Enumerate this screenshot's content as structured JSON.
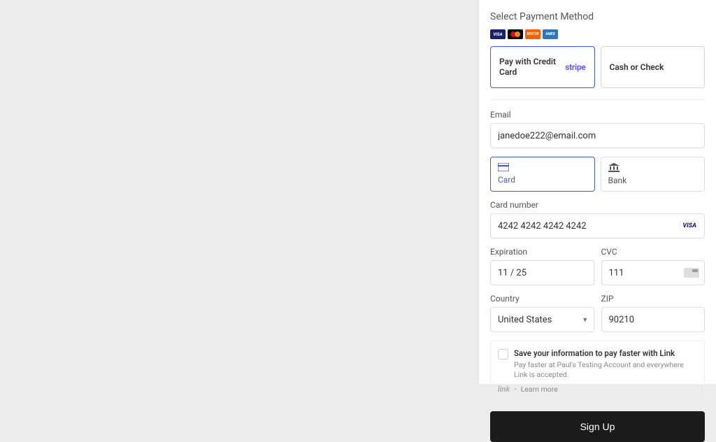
{
  "section_title": "Select Payment Method",
  "brands": {
    "visa": "VISA",
    "discover": "DISCVR",
    "amex": "AMEX"
  },
  "methods": {
    "credit": {
      "label": "Pay with Credit Card",
      "badge": "stripe"
    },
    "cash": {
      "label": "Cash or Check"
    }
  },
  "email": {
    "label": "Email",
    "value": "janedoe222@email.com"
  },
  "tabs": {
    "card": "Card",
    "bank": "Bank"
  },
  "card_number": {
    "label": "Card number",
    "value": "4242 4242 4242 4242",
    "brand": "VISA"
  },
  "expiration": {
    "label": "Expiration",
    "value": "11 / 25"
  },
  "cvc": {
    "label": "CVC",
    "value": "111"
  },
  "country": {
    "label": "Country",
    "value": "United States"
  },
  "zip": {
    "label": "ZIP",
    "value": "90210"
  },
  "link": {
    "title": "Save your information to pay faster with Link",
    "subtitle": "Pay faster at Paul's Testing Account and everywhere Link is accepted.",
    "logo": "link",
    "learn": "Learn more"
  },
  "submit": "Sign Up"
}
